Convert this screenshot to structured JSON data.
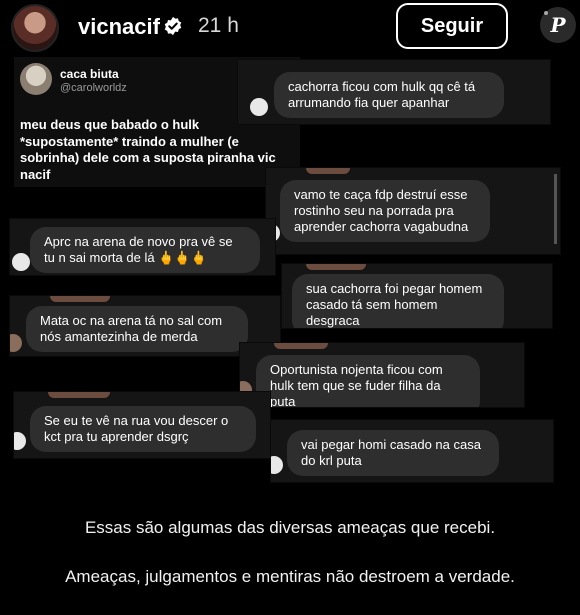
{
  "header": {
    "username": "vicnacif",
    "time": "21 h",
    "follow_label": "Seguir",
    "watermark": "P"
  },
  "tweet": {
    "name": "caca biuta",
    "handle": "@carolworldz",
    "text": "meu deus que babado o hulk *supostamente* traindo a mulher (e sobrinha) dele com a suposta piranha vic nacif"
  },
  "messages": [
    "cachorra ficou com hulk qq cê tá arrumando fia quer apanhar",
    "vamo te caça fdp destruí esse rostinho seu na porrada pra aprender cachorra vagabudna",
    "Aprc na arena de novo pra vê se tu n sai morta de lá 🖕🖕🖕",
    "sua cachorra foi pegar homem casado tá sem homem desgraca",
    "Mata oc na arena tá no sal com nós amantezinha de merda",
    "Oportunista nojenta ficou com hulk tem que se fuder filha da puta",
    "Se eu te vê na rua vou descer o kct pra tu aprender dsgrç",
    "vai pegar homi casado na casa do krl puta"
  ],
  "caption": {
    "line1": "Essas são algumas das diversas ameaças que recebi.",
    "line2": "Ameaças, julgamentos e mentiras não destroem a verdade."
  },
  "colors": {
    "background": "#000000",
    "bubble": "#2e2e2e",
    "text": "#ffffff",
    "verified": "#ffffff"
  }
}
